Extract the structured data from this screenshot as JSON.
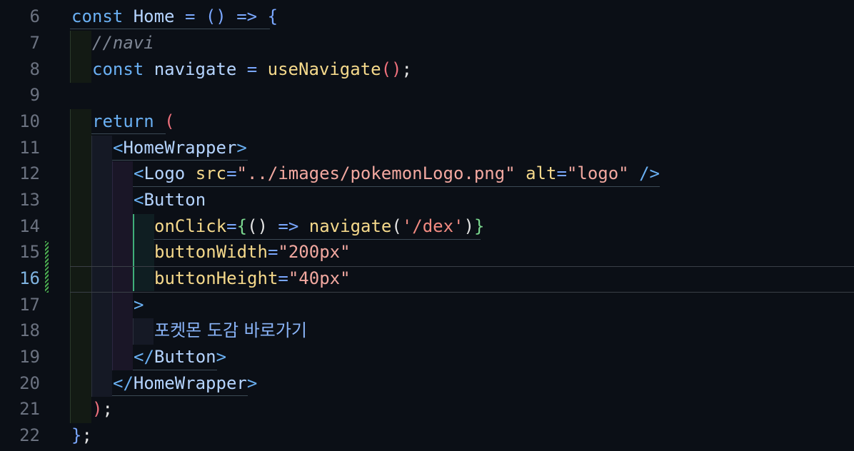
{
  "editor": {
    "current_line": "16",
    "lines": [
      {
        "num": "6"
      },
      {
        "num": "7",
        "comment": "//navi"
      },
      {
        "num": "8"
      },
      {
        "num": "9"
      },
      {
        "num": "10"
      },
      {
        "num": "11"
      },
      {
        "num": "12"
      },
      {
        "num": "13"
      },
      {
        "num": "14"
      },
      {
        "num": "15"
      },
      {
        "num": "16"
      },
      {
        "num": "17"
      },
      {
        "num": "18"
      },
      {
        "num": "19"
      },
      {
        "num": "20"
      },
      {
        "num": "21"
      },
      {
        "num": "22"
      }
    ],
    "tokens": {
      "const": "const",
      "home": "Home",
      "eq": " = ",
      "parens": "()",
      "arrow": " => ",
      "lbrace": "{",
      "navigate": "navigate",
      "useNavigate": "useNavigate",
      "call_parens": "()",
      "semi": ";",
      "return": "return",
      "lparen": " (",
      "home_wrapper": "HomeWrapper",
      "logo": "Logo",
      "src_attr": "src",
      "src_value": "\"../images/pokemonLogo.png\"",
      "alt_attr": "alt",
      "alt_value": "\"logo\"",
      "self_close": " />",
      "button": "Button",
      "onclick_attr": "onClick",
      "nav_arg": "'/dex'",
      "width_attr": "buttonWidth",
      "width_value": "\"200px\"",
      "height_attr": "buttonHeight",
      "height_value": "\"40px\"",
      "button_text": "포켓몬 도감 바로가기",
      "rparen_semi": ");",
      "end_brace": "};"
    }
  },
  "colors": {
    "background": "#0b0f16",
    "keyword": "#6ab0f3",
    "function": "#f5d98b",
    "string": "#f28b82",
    "comment": "#7e8694",
    "git_added": "#4caf50"
  }
}
